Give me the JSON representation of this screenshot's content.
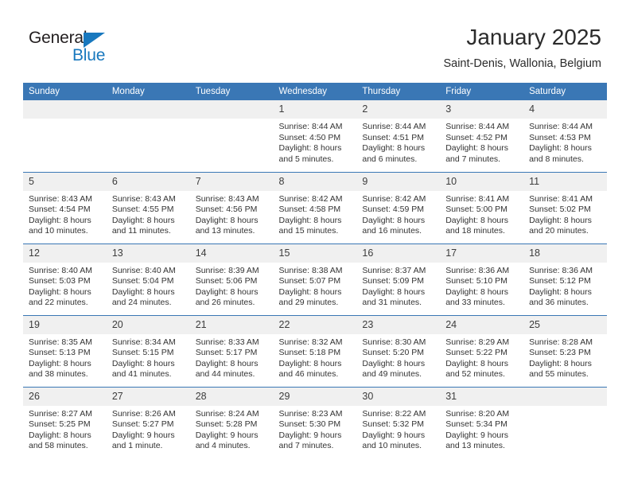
{
  "brand": {
    "name_part1": "General",
    "name_part2": "Blue",
    "logo_icon": "triangle-logo"
  },
  "header": {
    "title": "January 2025",
    "subtitle": "Saint-Denis, Wallonia, Belgium"
  },
  "calendar": {
    "weekday_headers": [
      "Sunday",
      "Monday",
      "Tuesday",
      "Wednesday",
      "Thursday",
      "Friday",
      "Saturday"
    ],
    "colors": {
      "header_blue": "#3a77b5",
      "daynum_background": "#f0f0f0",
      "brand_blue": "#1878be",
      "text": "#333333"
    },
    "weeks": [
      [
        {
          "day": "",
          "sunrise": "",
          "sunset": "",
          "daylight_line1": "",
          "daylight_line2": ""
        },
        {
          "day": "",
          "sunrise": "",
          "sunset": "",
          "daylight_line1": "",
          "daylight_line2": ""
        },
        {
          "day": "",
          "sunrise": "",
          "sunset": "",
          "daylight_line1": "",
          "daylight_line2": ""
        },
        {
          "day": "1",
          "sunrise": "Sunrise: 8:44 AM",
          "sunset": "Sunset: 4:50 PM",
          "daylight_line1": "Daylight: 8 hours",
          "daylight_line2": "and 5 minutes."
        },
        {
          "day": "2",
          "sunrise": "Sunrise: 8:44 AM",
          "sunset": "Sunset: 4:51 PM",
          "daylight_line1": "Daylight: 8 hours",
          "daylight_line2": "and 6 minutes."
        },
        {
          "day": "3",
          "sunrise": "Sunrise: 8:44 AM",
          "sunset": "Sunset: 4:52 PM",
          "daylight_line1": "Daylight: 8 hours",
          "daylight_line2": "and 7 minutes."
        },
        {
          "day": "4",
          "sunrise": "Sunrise: 8:44 AM",
          "sunset": "Sunset: 4:53 PM",
          "daylight_line1": "Daylight: 8 hours",
          "daylight_line2": "and 8 minutes."
        }
      ],
      [
        {
          "day": "5",
          "sunrise": "Sunrise: 8:43 AM",
          "sunset": "Sunset: 4:54 PM",
          "daylight_line1": "Daylight: 8 hours",
          "daylight_line2": "and 10 minutes."
        },
        {
          "day": "6",
          "sunrise": "Sunrise: 8:43 AM",
          "sunset": "Sunset: 4:55 PM",
          "daylight_line1": "Daylight: 8 hours",
          "daylight_line2": "and 11 minutes."
        },
        {
          "day": "7",
          "sunrise": "Sunrise: 8:43 AM",
          "sunset": "Sunset: 4:56 PM",
          "daylight_line1": "Daylight: 8 hours",
          "daylight_line2": "and 13 minutes."
        },
        {
          "day": "8",
          "sunrise": "Sunrise: 8:42 AM",
          "sunset": "Sunset: 4:58 PM",
          "daylight_line1": "Daylight: 8 hours",
          "daylight_line2": "and 15 minutes."
        },
        {
          "day": "9",
          "sunrise": "Sunrise: 8:42 AM",
          "sunset": "Sunset: 4:59 PM",
          "daylight_line1": "Daylight: 8 hours",
          "daylight_line2": "and 16 minutes."
        },
        {
          "day": "10",
          "sunrise": "Sunrise: 8:41 AM",
          "sunset": "Sunset: 5:00 PM",
          "daylight_line1": "Daylight: 8 hours",
          "daylight_line2": "and 18 minutes."
        },
        {
          "day": "11",
          "sunrise": "Sunrise: 8:41 AM",
          "sunset": "Sunset: 5:02 PM",
          "daylight_line1": "Daylight: 8 hours",
          "daylight_line2": "and 20 minutes."
        }
      ],
      [
        {
          "day": "12",
          "sunrise": "Sunrise: 8:40 AM",
          "sunset": "Sunset: 5:03 PM",
          "daylight_line1": "Daylight: 8 hours",
          "daylight_line2": "and 22 minutes."
        },
        {
          "day": "13",
          "sunrise": "Sunrise: 8:40 AM",
          "sunset": "Sunset: 5:04 PM",
          "daylight_line1": "Daylight: 8 hours",
          "daylight_line2": "and 24 minutes."
        },
        {
          "day": "14",
          "sunrise": "Sunrise: 8:39 AM",
          "sunset": "Sunset: 5:06 PM",
          "daylight_line1": "Daylight: 8 hours",
          "daylight_line2": "and 26 minutes."
        },
        {
          "day": "15",
          "sunrise": "Sunrise: 8:38 AM",
          "sunset": "Sunset: 5:07 PM",
          "daylight_line1": "Daylight: 8 hours",
          "daylight_line2": "and 29 minutes."
        },
        {
          "day": "16",
          "sunrise": "Sunrise: 8:37 AM",
          "sunset": "Sunset: 5:09 PM",
          "daylight_line1": "Daylight: 8 hours",
          "daylight_line2": "and 31 minutes."
        },
        {
          "day": "17",
          "sunrise": "Sunrise: 8:36 AM",
          "sunset": "Sunset: 5:10 PM",
          "daylight_line1": "Daylight: 8 hours",
          "daylight_line2": "and 33 minutes."
        },
        {
          "day": "18",
          "sunrise": "Sunrise: 8:36 AM",
          "sunset": "Sunset: 5:12 PM",
          "daylight_line1": "Daylight: 8 hours",
          "daylight_line2": "and 36 minutes."
        }
      ],
      [
        {
          "day": "19",
          "sunrise": "Sunrise: 8:35 AM",
          "sunset": "Sunset: 5:13 PM",
          "daylight_line1": "Daylight: 8 hours",
          "daylight_line2": "and 38 minutes."
        },
        {
          "day": "20",
          "sunrise": "Sunrise: 8:34 AM",
          "sunset": "Sunset: 5:15 PM",
          "daylight_line1": "Daylight: 8 hours",
          "daylight_line2": "and 41 minutes."
        },
        {
          "day": "21",
          "sunrise": "Sunrise: 8:33 AM",
          "sunset": "Sunset: 5:17 PM",
          "daylight_line1": "Daylight: 8 hours",
          "daylight_line2": "and 44 minutes."
        },
        {
          "day": "22",
          "sunrise": "Sunrise: 8:32 AM",
          "sunset": "Sunset: 5:18 PM",
          "daylight_line1": "Daylight: 8 hours",
          "daylight_line2": "and 46 minutes."
        },
        {
          "day": "23",
          "sunrise": "Sunrise: 8:30 AM",
          "sunset": "Sunset: 5:20 PM",
          "daylight_line1": "Daylight: 8 hours",
          "daylight_line2": "and 49 minutes."
        },
        {
          "day": "24",
          "sunrise": "Sunrise: 8:29 AM",
          "sunset": "Sunset: 5:22 PM",
          "daylight_line1": "Daylight: 8 hours",
          "daylight_line2": "and 52 minutes."
        },
        {
          "day": "25",
          "sunrise": "Sunrise: 8:28 AM",
          "sunset": "Sunset: 5:23 PM",
          "daylight_line1": "Daylight: 8 hours",
          "daylight_line2": "and 55 minutes."
        }
      ],
      [
        {
          "day": "26",
          "sunrise": "Sunrise: 8:27 AM",
          "sunset": "Sunset: 5:25 PM",
          "daylight_line1": "Daylight: 8 hours",
          "daylight_line2": "and 58 minutes."
        },
        {
          "day": "27",
          "sunrise": "Sunrise: 8:26 AM",
          "sunset": "Sunset: 5:27 PM",
          "daylight_line1": "Daylight: 9 hours",
          "daylight_line2": "and 1 minute."
        },
        {
          "day": "28",
          "sunrise": "Sunrise: 8:24 AM",
          "sunset": "Sunset: 5:28 PM",
          "daylight_line1": "Daylight: 9 hours",
          "daylight_line2": "and 4 minutes."
        },
        {
          "day": "29",
          "sunrise": "Sunrise: 8:23 AM",
          "sunset": "Sunset: 5:30 PM",
          "daylight_line1": "Daylight: 9 hours",
          "daylight_line2": "and 7 minutes."
        },
        {
          "day": "30",
          "sunrise": "Sunrise: 8:22 AM",
          "sunset": "Sunset: 5:32 PM",
          "daylight_line1": "Daylight: 9 hours",
          "daylight_line2": "and 10 minutes."
        },
        {
          "day": "31",
          "sunrise": "Sunrise: 8:20 AM",
          "sunset": "Sunset: 5:34 PM",
          "daylight_line1": "Daylight: 9 hours",
          "daylight_line2": "and 13 minutes."
        },
        {
          "day": "",
          "sunrise": "",
          "sunset": "",
          "daylight_line1": "",
          "daylight_line2": ""
        }
      ]
    ]
  }
}
